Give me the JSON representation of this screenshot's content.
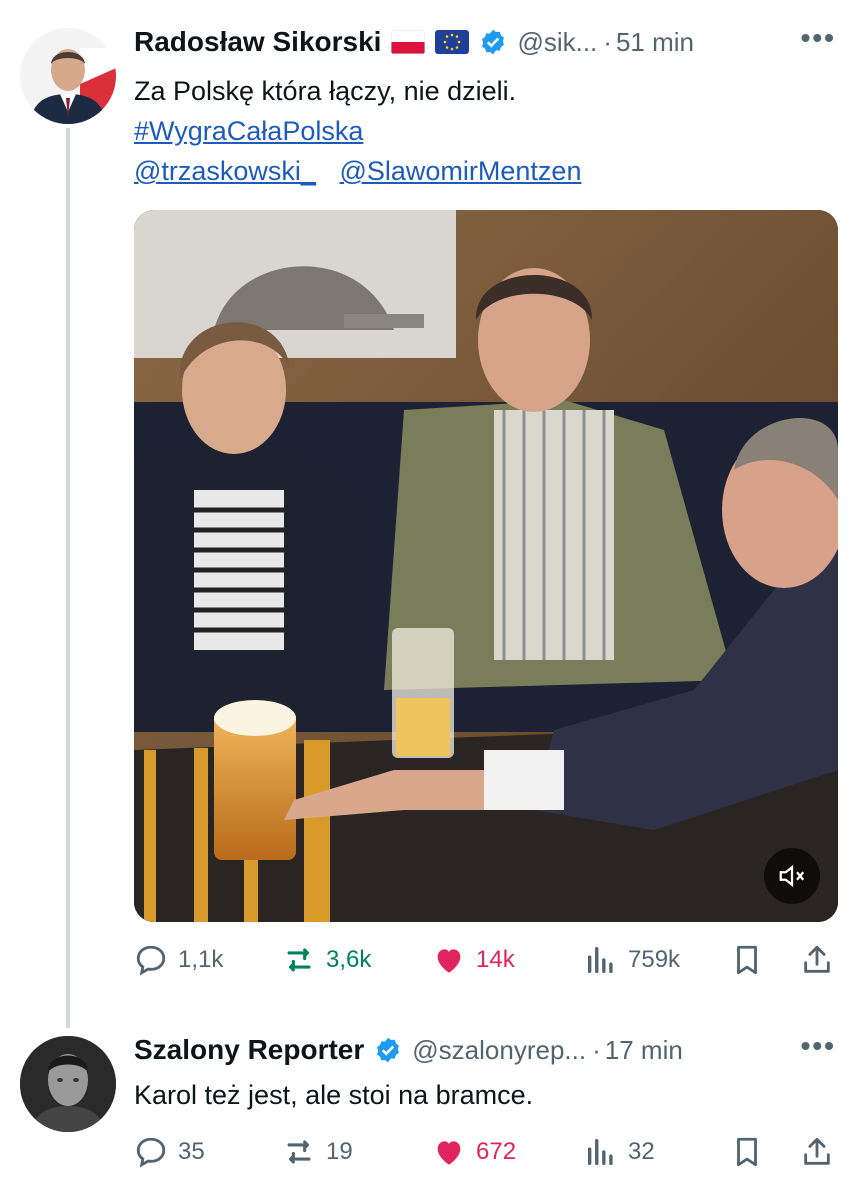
{
  "tweets": [
    {
      "author": "Radosław Sikorski",
      "flags": [
        "pl-flag-icon",
        "eu-flag-icon"
      ],
      "handle": "@sik...",
      "time": "51 min",
      "separator": "·",
      "text": "Za Polskę która łączy, nie dzieli.",
      "hashtag": "#WygraCałaPolska",
      "mentions": [
        "@trzaskowski_",
        "@SlawomirMentzen"
      ],
      "media": {
        "type": "video",
        "muted": true
      },
      "stats": {
        "replies": "1,1k",
        "retweets": "3,6k",
        "likes": "14k",
        "views": "759k"
      }
    },
    {
      "author": "Szalony Reporter",
      "handle": "@szalonyrep...",
      "time": "17 min",
      "separator": "·",
      "text": "Karol też jest, ale stoi na bramce.",
      "stats": {
        "replies": "35",
        "retweets": "19",
        "likes": "672",
        "views": "32"
      }
    }
  ],
  "colors": {
    "like": "#e0245e",
    "retweet": "#00835b",
    "link": "#1d5bbf",
    "verified": "#1d9bf0",
    "muted": "#536471"
  }
}
